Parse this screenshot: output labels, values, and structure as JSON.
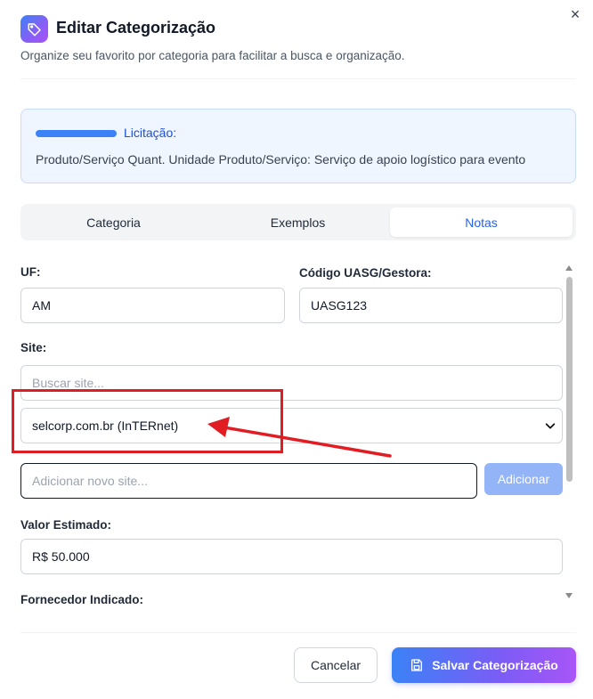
{
  "dialog": {
    "title": "Editar Categorização",
    "subtitle": "Organize seu favorito por categoria para facilitar a busca e organização.",
    "close_label": "×"
  },
  "info": {
    "label": "Licitação:",
    "description": "Produto/Serviço Quant. Unidade Produto/Serviço: Serviço de apoio logístico para evento"
  },
  "tabs": [
    {
      "label": "Categoria",
      "active": false
    },
    {
      "label": "Exemplos",
      "active": false
    },
    {
      "label": "Notas",
      "active": true
    }
  ],
  "form": {
    "uf": {
      "label": "UF:",
      "value": "AM"
    },
    "uasg": {
      "label": "Código UASG/Gestora:",
      "value": "UASG123"
    },
    "site": {
      "label": "Site:",
      "search_placeholder": "Buscar site...",
      "selected": "selcorp.com.br (InTERnet)",
      "new_placeholder": "Adicionar novo site...",
      "add_button": "Adicionar"
    },
    "valor": {
      "label": "Valor Estimado:",
      "value": "R$ 50.000"
    },
    "fornecedor": {
      "label": "Fornecedor Indicado:"
    }
  },
  "footer": {
    "cancel": "Cancelar",
    "save": "Salvar Categorização"
  },
  "colors": {
    "accent": "#3b82f6",
    "accent_purple": "#a855f7",
    "annotation_red": "#e11d24"
  },
  "icons": {
    "header": "tag-icon",
    "close": "close-icon",
    "save": "save-icon",
    "select": "chevron-down-icon"
  }
}
